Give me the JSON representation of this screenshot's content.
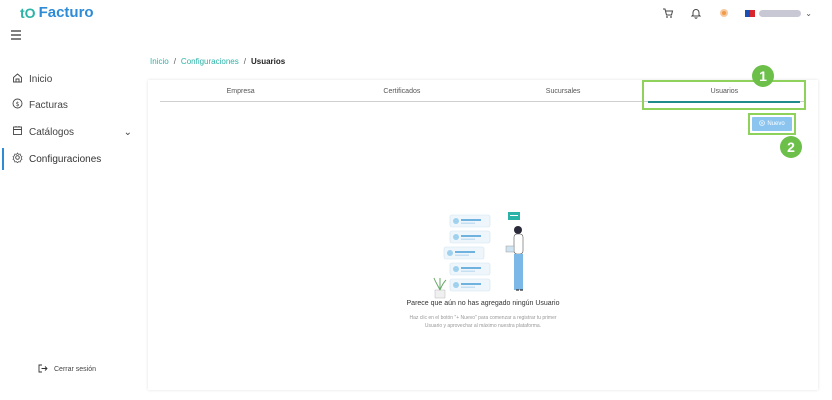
{
  "app": {
    "name": "Facturo",
    "logo_mark": "tO"
  },
  "header": {
    "icons": [
      "cart-icon",
      "bell-icon",
      "coin-icon"
    ],
    "user_caret": "⌄"
  },
  "sidebar": {
    "items": [
      {
        "label": "Inicio",
        "icon": "home-icon"
      },
      {
        "label": "Facturas",
        "icon": "dollar-circle-icon"
      },
      {
        "label": "Catálogos",
        "icon": "catalog-icon"
      },
      {
        "label": "Configuraciones",
        "icon": "gear-icon"
      }
    ],
    "expand_glyph": "⌄",
    "logout_label": "Cerrar sesión"
  },
  "breadcrumb": {
    "home": "Inicio",
    "section": "Configuraciones",
    "current": "Usuarios",
    "sep": "/"
  },
  "tabs": [
    {
      "label": "Empresa"
    },
    {
      "label": "Certificados"
    },
    {
      "label": "Sucursales"
    },
    {
      "label": "Usuarios"
    }
  ],
  "actions": {
    "new_label": "Nuevo"
  },
  "callouts": {
    "one": "1",
    "two": "2"
  },
  "empty_state": {
    "title": "Parece que aún no has agregado ningún Usuario",
    "description": "Haz clic en el botón \"+ Nuevo\" para comenzar a registrar tu primer Usuario y aprovechar al máximo nuestra plataforma."
  },
  "colors": {
    "brand": "#2e8bd6",
    "accent": "#2bb3a8",
    "callout": "#6cc04a",
    "button": "#8ac4ef"
  }
}
